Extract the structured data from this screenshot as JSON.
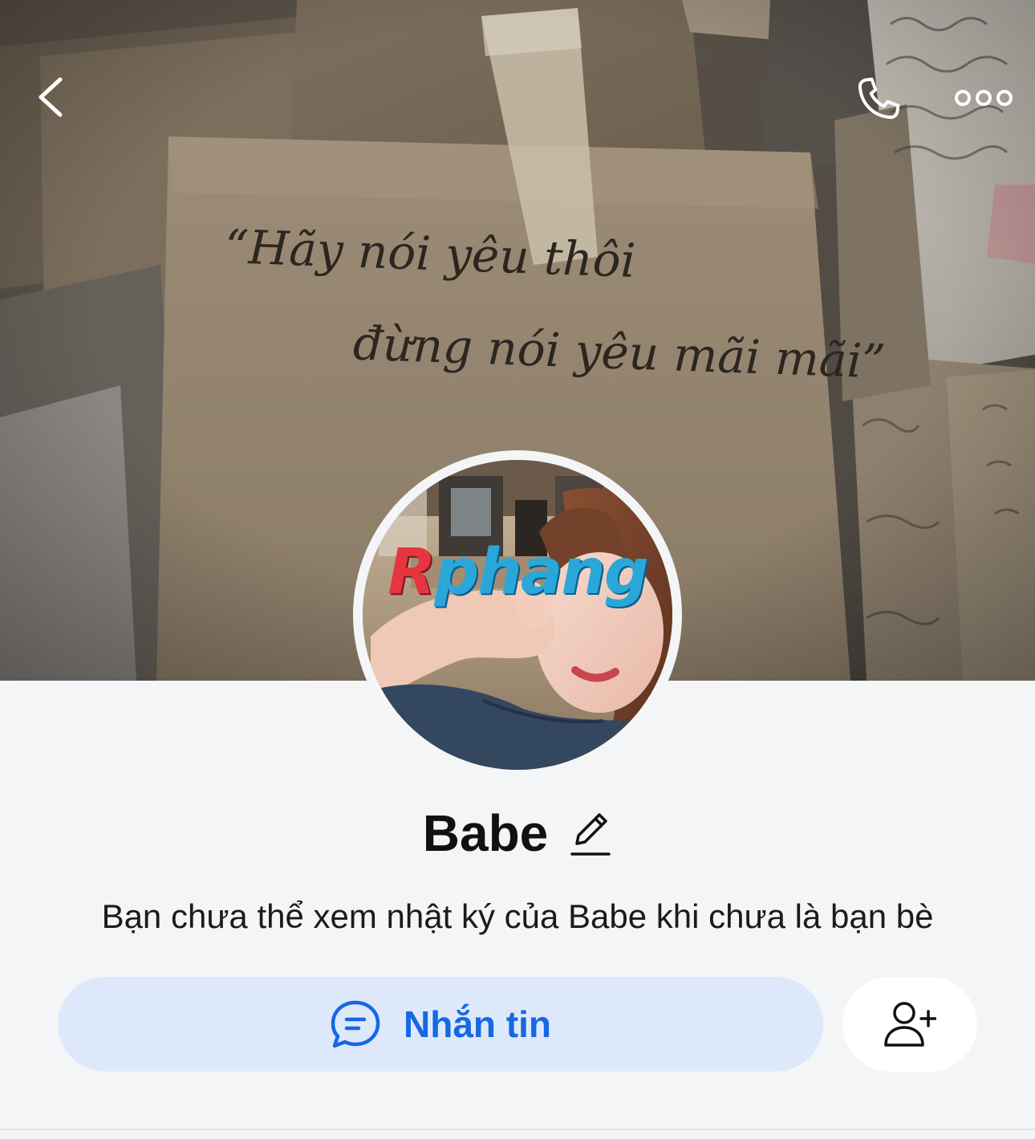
{
  "header": {
    "back_icon": "chevron-left-icon",
    "call_icon": "phone-icon",
    "more_icon": "more-horizontal-icon"
  },
  "cover": {
    "quote_line1": "“Hãy nói yêu thôi",
    "quote_line2": "đừng nói yêu mãi mãi”"
  },
  "avatar": {
    "watermark_prefix": "R",
    "watermark_suffix": "phang"
  },
  "profile": {
    "name": "Babe",
    "edit_icon": "pencil-icon",
    "notice": "Bạn chưa thể xem nhật ký của Babe khi chưa là bạn bè"
  },
  "actions": {
    "message_label": "Nhắn tin",
    "message_icon": "chat-bubble-icon",
    "add_friend_icon": "add-friend-icon"
  },
  "colors": {
    "accent": "#1668e3",
    "message_button_bg": "#dde9fb",
    "page_bg": "#f4f5f7"
  }
}
